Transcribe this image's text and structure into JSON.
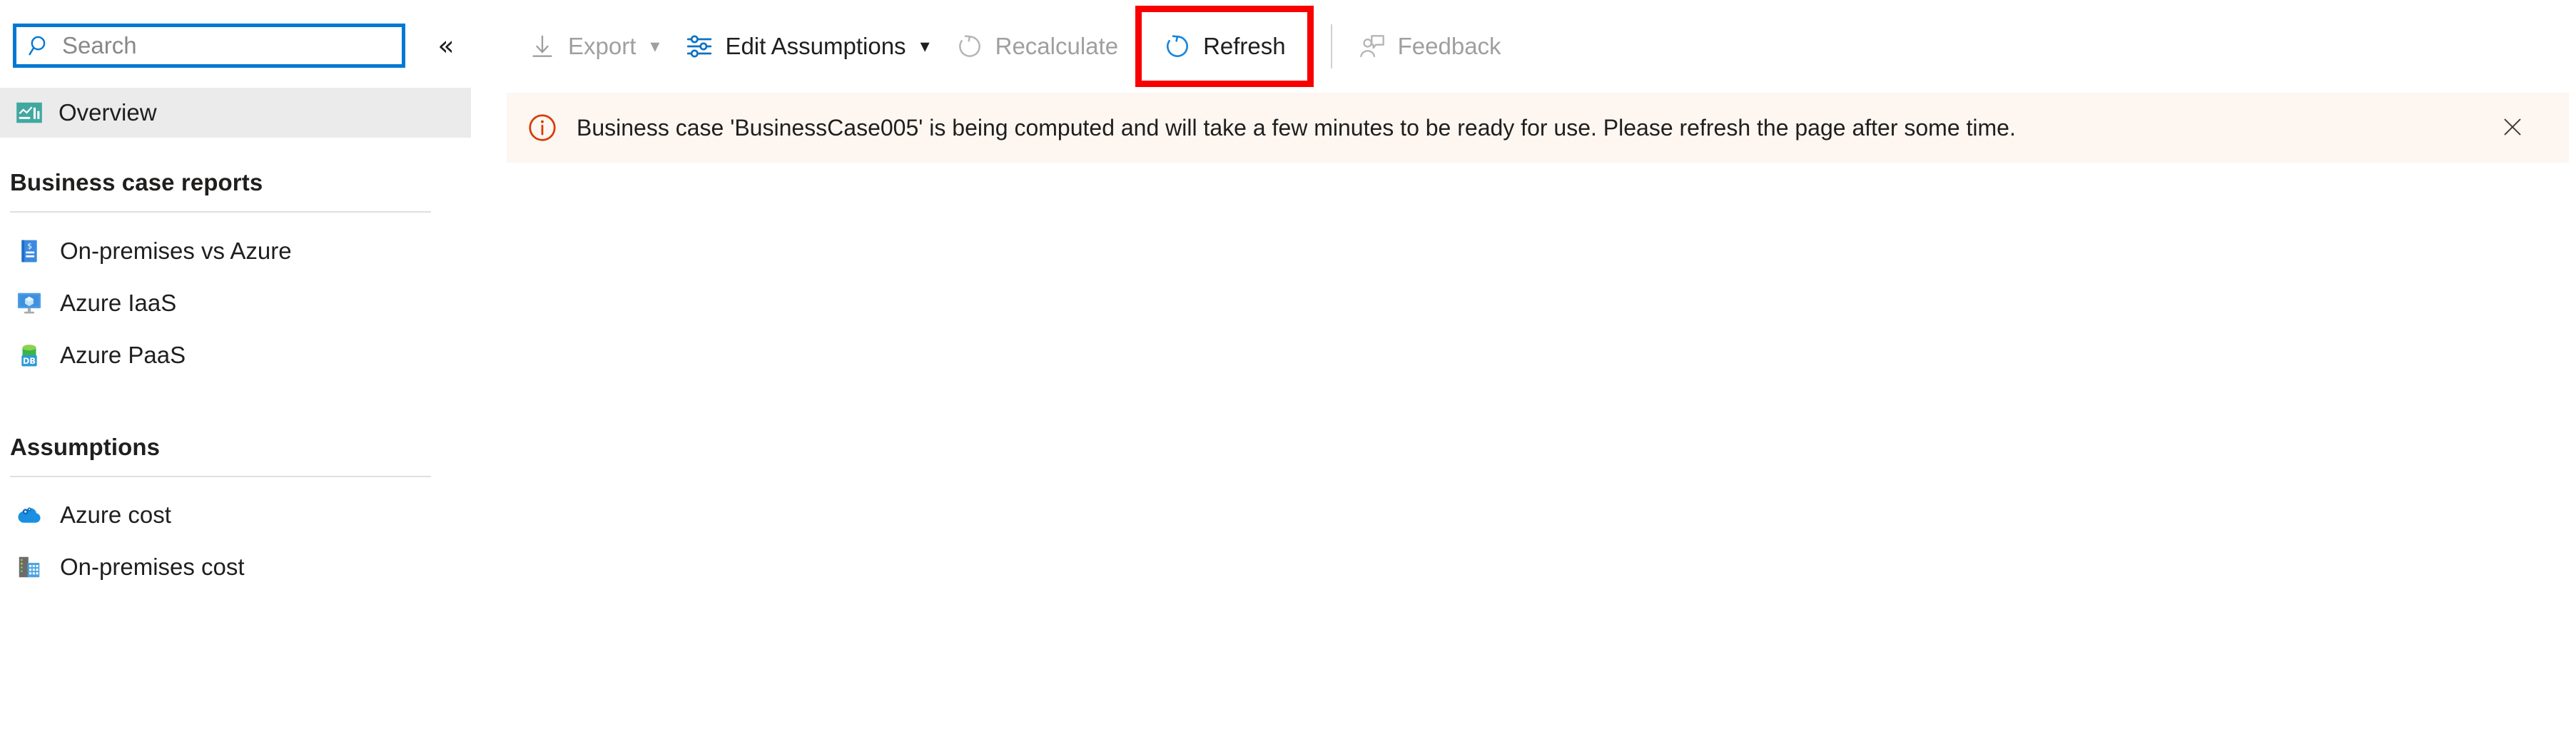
{
  "search": {
    "placeholder": "Search",
    "value": "",
    "icon": "search-icon"
  },
  "sidebar": {
    "collapse_glyph": "«",
    "collapse_name": "collapse-sidebar-button",
    "overview": {
      "label": "Overview",
      "icon": "overview-chart-icon",
      "selected": true
    },
    "sections": [
      {
        "title": "Business case reports",
        "items": [
          {
            "label": "On-premises vs Azure",
            "icon": "cost-report-icon"
          },
          {
            "label": "Azure IaaS",
            "icon": "azure-vm-icon"
          },
          {
            "label": "Azure PaaS",
            "icon": "azure-database-icon"
          }
        ]
      },
      {
        "title": "Assumptions",
        "items": [
          {
            "label": "Azure cost",
            "icon": "azure-cloud-cost-icon"
          },
          {
            "label": "On-premises cost",
            "icon": "on-premises-server-icon"
          }
        ]
      }
    ]
  },
  "toolbar": {
    "commands": [
      {
        "id": "export",
        "label": "Export",
        "icon": "download-icon",
        "enabled": false,
        "has_caret": true
      },
      {
        "id": "edit-assumptions",
        "label": "Edit Assumptions",
        "icon": "sliders-icon",
        "enabled": true,
        "has_caret": true
      },
      {
        "id": "recalculate",
        "label": "Recalculate",
        "icon": "recalculate-icon",
        "enabled": false,
        "has_caret": false
      },
      {
        "id": "refresh",
        "label": "Refresh",
        "icon": "refresh-icon",
        "enabled": true,
        "has_caret": false,
        "highlighted": true
      },
      {
        "id": "feedback",
        "label": "Feedback",
        "icon": "feedback-person-icon",
        "enabled": false,
        "has_caret": false
      }
    ]
  },
  "banner": {
    "severity": "info",
    "icon": "info-circle-icon",
    "message": "Business case 'BusinessCase005' is being computed and will take a few minutes to be ready for use. Please refresh the page after some time.",
    "close_label": "Close",
    "close_icon": "close-icon"
  },
  "colors": {
    "accent_blue": "#0078d4",
    "highlight_red": "#f90000",
    "banner_bg": "#fdf6f1",
    "banner_icon": "#d83b01",
    "selected_nav_bg": "#ebebeb",
    "disabled_text": "#a19f9d",
    "text": "#201f1e"
  }
}
